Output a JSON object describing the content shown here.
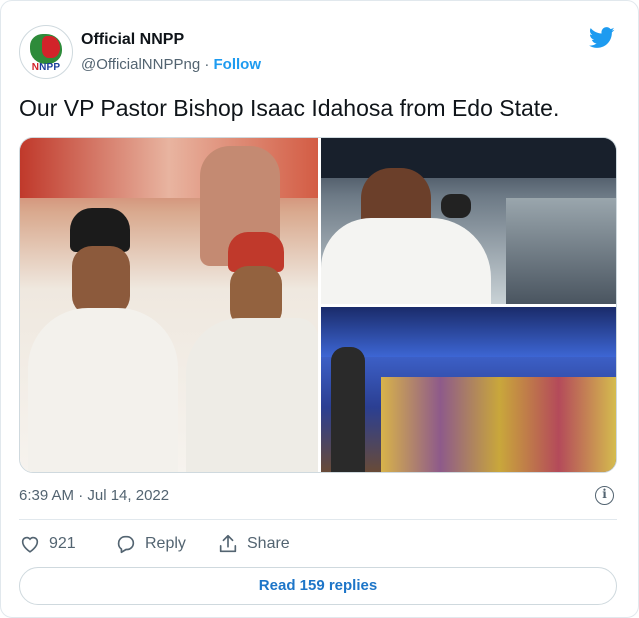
{
  "account": {
    "name": "Official NNPP",
    "handle": "@OfficialNNPPng",
    "separator": " · ",
    "follow_label": "Follow",
    "avatar_text": {
      "part1": "N",
      "part2": "NPP"
    }
  },
  "icons": {
    "brand": "twitter-bird-icon",
    "like": "heart-icon",
    "reply": "reply-bubble-icon",
    "share": "share-upload-icon",
    "info": "info-icon"
  },
  "tweet": {
    "text": "Our VP Pastor Bishop Isaac Idahosa from Edo State.",
    "timestamp": "6:39 AM · Jul 14, 2022",
    "info_glyph": "i"
  },
  "actions": {
    "like_count": "921",
    "reply_label": "Reply",
    "share_label": "Share"
  },
  "replies_button": "Read 159 replies",
  "colors": {
    "accent": "#1d9bf0",
    "link_button": "#1d75c8",
    "text_primary": "#0f1419",
    "text_secondary": "#536471",
    "border": "#cfd9de"
  }
}
